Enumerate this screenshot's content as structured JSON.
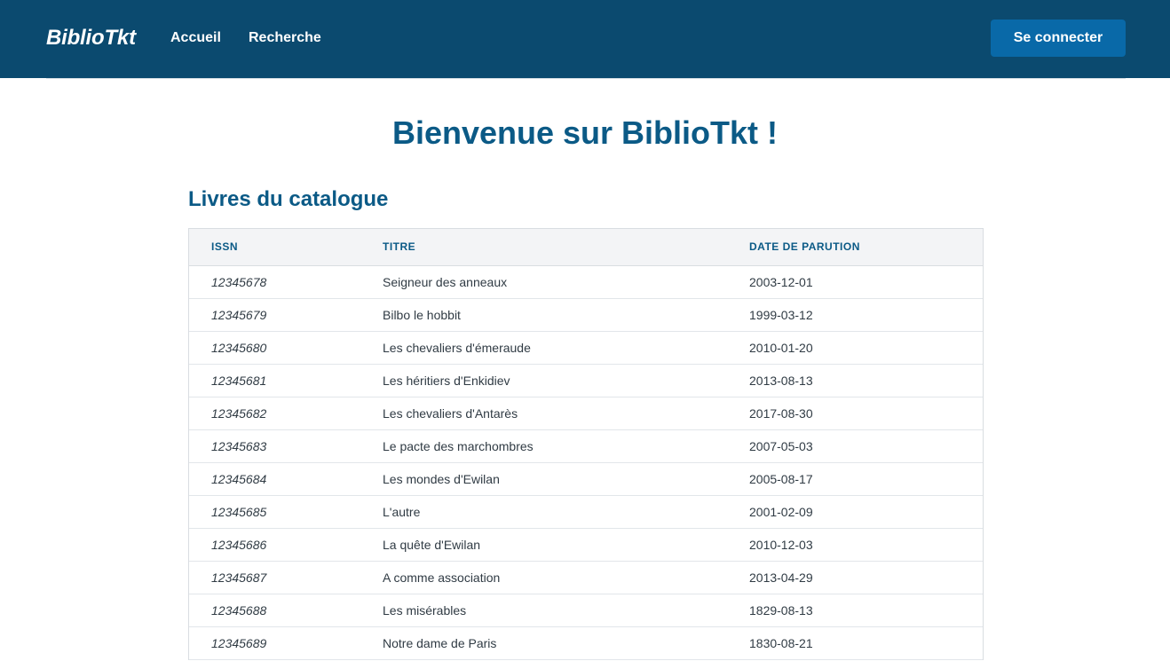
{
  "header": {
    "brand": "BiblioTkt",
    "nav": [
      {
        "label": "Accueil"
      },
      {
        "label": "Recherche"
      }
    ],
    "login_label": "Se connecter"
  },
  "main": {
    "title": "Bienvenue sur BiblioTkt !",
    "catalog": {
      "heading": "Livres du catalogue",
      "columns": [
        "ISSN",
        "TITRE",
        "DATE DE PARUTION"
      ],
      "rows": [
        {
          "issn": "12345678",
          "title": "Seigneur des anneaux",
          "date": "2003-12-01"
        },
        {
          "issn": "12345679",
          "title": "Bilbo le hobbit",
          "date": "1999-03-12"
        },
        {
          "issn": "12345680",
          "title": "Les chevaliers d'émeraude",
          "date": "2010-01-20"
        },
        {
          "issn": "12345681",
          "title": "Les héritiers d'Enkidiev",
          "date": "2013-08-13"
        },
        {
          "issn": "12345682",
          "title": "Les chevaliers d'Antarès",
          "date": "2017-08-30"
        },
        {
          "issn": "12345683",
          "title": "Le pacte des marchombres",
          "date": "2007-05-03"
        },
        {
          "issn": "12345684",
          "title": "Les mondes d'Ewilan",
          "date": "2005-08-17"
        },
        {
          "issn": "12345685",
          "title": "L'autre",
          "date": "2001-02-09"
        },
        {
          "issn": "12345686",
          "title": "La quête d'Ewilan",
          "date": "2010-12-03"
        },
        {
          "issn": "12345687",
          "title": "A comme association",
          "date": "2013-04-29"
        },
        {
          "issn": "12345688",
          "title": "Les misérables",
          "date": "1829-08-13"
        },
        {
          "issn": "12345689",
          "title": "Notre dame de Paris",
          "date": "1830-08-21"
        }
      ]
    }
  },
  "colors": {
    "navbar": "#0b4a6f",
    "button": "#0969a8",
    "accent_text": "#0b5a86",
    "table_header_bg": "#f3f4f6"
  }
}
